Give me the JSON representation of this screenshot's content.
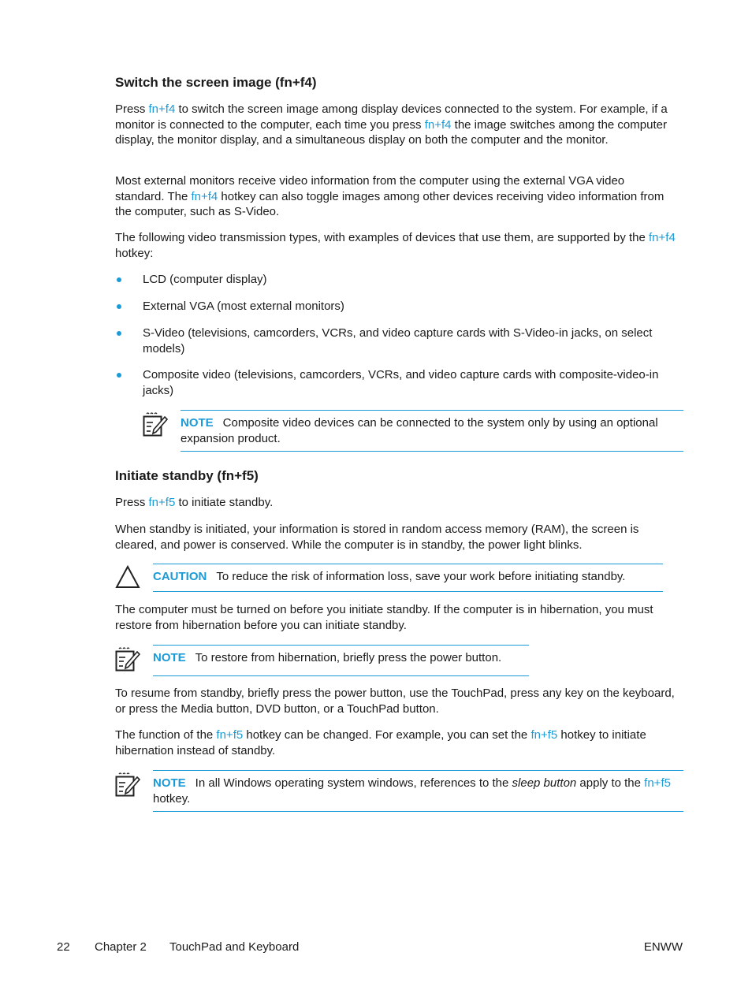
{
  "section1": {
    "heading": "Switch the screen image (fn+f4)",
    "para1": {
      "parts": [
        "Press ",
        "fn+f4",
        " to switch the screen image among display devices connected to the system. For example, if a monitor is connected to the computer, each time you press ",
        "fn+f4",
        " the image switches among the computer display, the monitor display, and a simultaneous display on both the computer and the monitor."
      ]
    },
    "para2": {
      "parts": [
        "Most external monitors receive video information from the computer using the external VGA video standard. The ",
        "fn+f4",
        " hotkey can also toggle images among other devices receiving video information from the computer, such as S-Video."
      ]
    },
    "para3": {
      "parts": [
        "The following video transmission types, with examples of devices that use them, are supported by the ",
        "fn+f4",
        " hotkey:"
      ]
    },
    "bullets": [
      "LCD (computer display)",
      "External VGA (most external monitors)",
      "S-Video (televisions, camcorders, VCRs, and video capture cards with S-Video-in jacks, on select models)",
      "Composite video (televisions, camcorders, VCRs, and video capture cards with composite-video-in jacks)"
    ],
    "note": {
      "label": "NOTE",
      "text": "Composite video devices can be connected to the system only by using an optional expansion product."
    }
  },
  "section2": {
    "heading": "Initiate standby (fn+f5)",
    "para1": {
      "parts": [
        "Press ",
        "fn+f5",
        " to initiate standby."
      ]
    },
    "para2": "When standby is initiated, your information is stored in random access memory (RAM), the screen is cleared, and power is conserved. While the computer is in standby, the power light blinks.",
    "caution": {
      "label": "CAUTION",
      "text": "To reduce the risk of information loss, save your work before initiating standby."
    },
    "para3": "The computer must be turned on before you initiate standby. If the computer is in hibernation, you must restore from hibernation before you can initiate standby.",
    "note1": {
      "label": "NOTE",
      "text": "To restore from hibernation, briefly press the power button."
    },
    "para4": "To resume from standby, briefly press the power button, use the TouchPad, press any key on the keyboard, or press the Media button, DVD button, or a TouchPad button.",
    "para5": {
      "parts": [
        "The function of the ",
        "fn+f5",
        " hotkey can be changed. For example, you can set the ",
        "fn+f5",
        " hotkey to initiate hibernation instead of standby."
      ]
    },
    "note2": {
      "label": "NOTE",
      "parts": [
        "In all Windows operating system windows, references to the ",
        "sleep button",
        " apply to the ",
        "fn+f5",
        " hotkey."
      ]
    }
  },
  "footer": {
    "page_number": "22",
    "chapter": "Chapter 2",
    "chapter_title": "TouchPad and Keyboard",
    "locale": "ENWW"
  },
  "colors": {
    "accent": "#1a9bd7",
    "text": "#1a1a1a"
  }
}
